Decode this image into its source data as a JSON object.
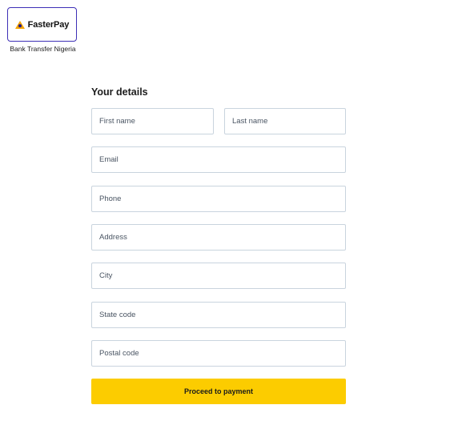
{
  "payment_method": {
    "logo_text": "FasterPay",
    "logo_icon": "fasterpay-logo-icon",
    "caption": "Bank Transfer Nigeria",
    "border_color": "#3d2fb6",
    "icon_colors": [
      "#f5a300",
      "#1f1a8f"
    ]
  },
  "form": {
    "title": "Your details",
    "fields": {
      "first_name": {
        "placeholder": "First name",
        "value": ""
      },
      "last_name": {
        "placeholder": "Last name",
        "value": ""
      },
      "email": {
        "placeholder": "Email",
        "value": ""
      },
      "phone": {
        "placeholder": "Phone",
        "value": ""
      },
      "address": {
        "placeholder": "Address",
        "value": ""
      },
      "city": {
        "placeholder": "City",
        "value": ""
      },
      "state_code": {
        "placeholder": "State code",
        "value": ""
      },
      "postal_code": {
        "placeholder": "Postal code",
        "value": ""
      }
    },
    "submit_label": "Proceed to payment",
    "submit_color": "#fccc00"
  }
}
